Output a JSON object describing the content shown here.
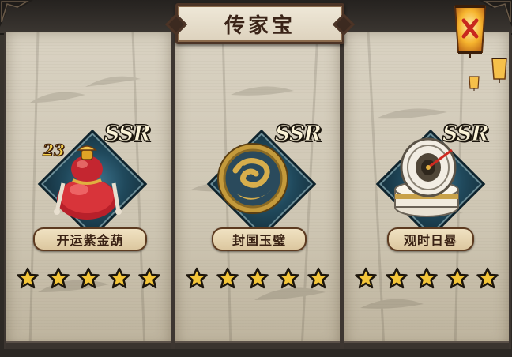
{
  "header": {
    "title": "传家宝"
  },
  "items": [
    {
      "name": "开运紫金葫",
      "rarity": "SSR",
      "stars": 5,
      "icon": "gourd-icon",
      "badge": "23"
    },
    {
      "name": "封国玉璧",
      "rarity": "SSR",
      "stars": 5,
      "icon": "jade-disc-icon"
    },
    {
      "name": "观时日晷",
      "rarity": "SSR",
      "stars": 5,
      "icon": "sundial-icon"
    }
  ],
  "colors": {
    "panel": "#d6cfbf",
    "emblem": "#2a5a70",
    "star": "#f3c53a",
    "gourd": "#c7262a",
    "jade": "#c49a3b"
  }
}
